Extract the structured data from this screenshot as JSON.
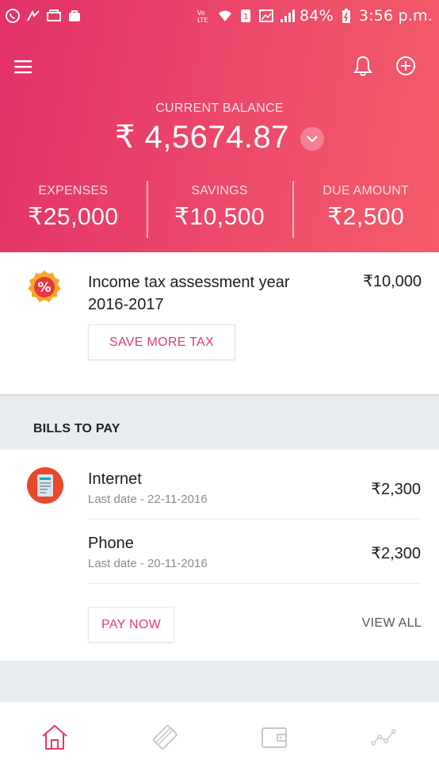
{
  "status_bar": {
    "left_icons": [
      "whatsapp-icon",
      "crossword-icon",
      "gallery-icon",
      "bag-icon"
    ],
    "right_icons": [
      "volte-icon",
      "wifi-icon",
      "sim-icon",
      "image-icon",
      "signal-icon",
      "battery-icon"
    ],
    "battery": "84%",
    "time": "3:56 p.m."
  },
  "header": {
    "menu_icon": "hamburger-icon",
    "notification_icon": "bell-icon",
    "add_icon": "plus-circle-icon"
  },
  "balance": {
    "label": "CURRENT BALANCE",
    "value": "₹ 4,5674.87",
    "toggle_icon": "chevron-down-icon"
  },
  "stats": [
    {
      "label": "EXPENSES",
      "value": "₹25,000"
    },
    {
      "label": "SAVINGS",
      "value": "₹10,500"
    },
    {
      "label": "DUE AMOUNT",
      "value": "₹2,500"
    }
  ],
  "tax": {
    "icon": "percent-badge-icon",
    "title": "Income tax assessment year 2016-2017",
    "amount": "₹10,000",
    "button": "SAVE MORE TAX"
  },
  "bills": {
    "header": "BILLS TO  PAY",
    "icon": "bill-receipt-icon",
    "items": [
      {
        "name": "Internet",
        "date": "Last date - 22-11-2016",
        "amount": "₹2,300"
      },
      {
        "name": "Phone",
        "date": "Last date - 20-11-2016",
        "amount": "₹2,300"
      }
    ],
    "pay_button": "PAY NOW",
    "view_all": "VIEW ALL"
  },
  "bottom_nav": {
    "items": [
      "home-icon",
      "cards-icon",
      "wallet-icon",
      "analytics-icon"
    ],
    "active_color": "#e23a68",
    "inactive_color": "#c8c8c8"
  },
  "colors": {
    "brand": "#e8396a",
    "accent_text": "#e23a68",
    "section_bg": "#e9ecef"
  }
}
